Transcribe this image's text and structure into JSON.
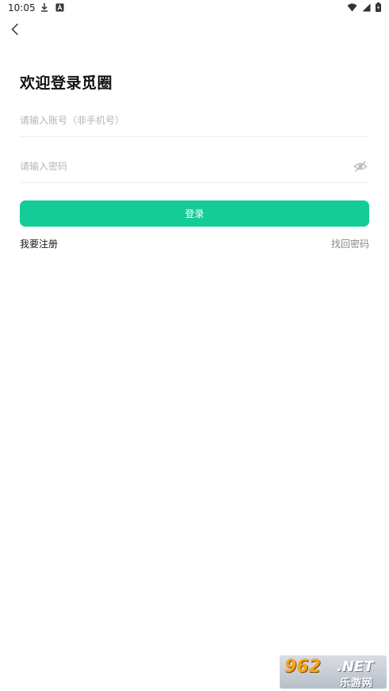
{
  "status_bar": {
    "time": "10:05",
    "icons_left": [
      "download-icon",
      "notification-a-icon"
    ],
    "icons_right": [
      "wifi-icon",
      "cell-signal-icon",
      "battery-icon"
    ]
  },
  "nav": {
    "back_icon": "chevron-left-icon"
  },
  "header": {
    "title": "欢迎登录觅圈"
  },
  "form": {
    "account_placeholder": "请输入账号（非手机号）",
    "account_value": "",
    "password_placeholder": "请输入密码",
    "password_value": "",
    "password_toggle_icon": "eye-off-icon"
  },
  "actions": {
    "login_label": "登录",
    "register_label": "我要注册",
    "forgot_label": "找回密码"
  },
  "theme": {
    "accent": "#15cb96"
  },
  "watermark": {
    "number": "962",
    "suffix": ".NET",
    "label": "乐游网"
  }
}
